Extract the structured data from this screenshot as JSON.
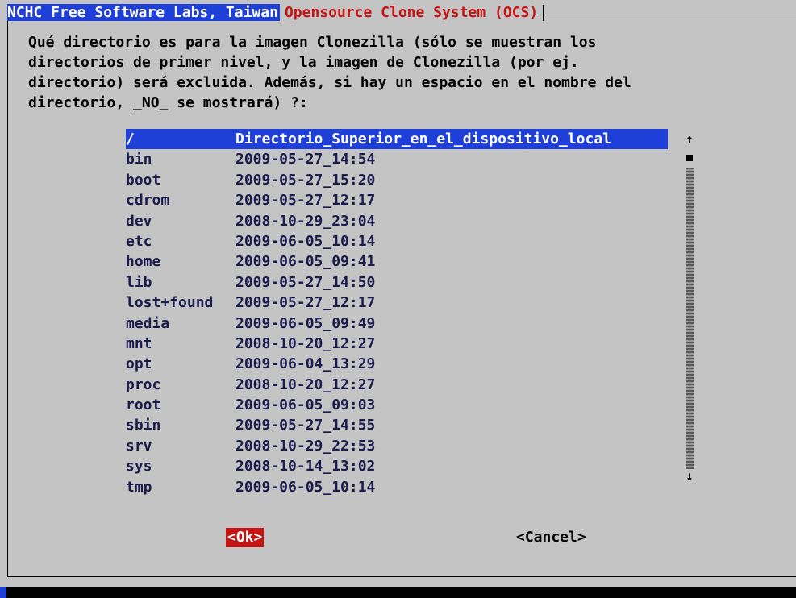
{
  "title": {
    "left": "NCHC Free Software Labs, Taiwan",
    "right": "Opensource Clone System (OCS)"
  },
  "prompt": "Qué directorio es para la imagen Clonezilla (sólo se muestran los\ndirectorios de primer nivel, y la imagen de Clonezilla (por ej.\ndirectorio) será excluida. Además, si hay un espacio en el nombre del\ndirectorio, _NO_ se mostrará) ?:",
  "list": [
    {
      "name": "/",
      "date": "Directorio_Superior_en_el_dispositivo_local",
      "selected": true
    },
    {
      "name": "bin",
      "date": "2009-05-27_14:54"
    },
    {
      "name": "boot",
      "date": "2009-05-27_15:20"
    },
    {
      "name": "cdrom",
      "date": "2009-05-27_12:17"
    },
    {
      "name": "dev",
      "date": "2008-10-29_23:04"
    },
    {
      "name": "etc",
      "date": "2009-06-05_10:14"
    },
    {
      "name": "home",
      "date": "2009-06-05_09:41"
    },
    {
      "name": "lib",
      "date": "2009-05-27_14:50"
    },
    {
      "name": "lost+found",
      "date": "2009-05-27_12:17"
    },
    {
      "name": "media",
      "date": "2009-06-05_09:49"
    },
    {
      "name": "mnt",
      "date": "2008-10-20_12:27"
    },
    {
      "name": "opt",
      "date": "2009-06-04_13:29"
    },
    {
      "name": "proc",
      "date": "2008-10-20_12:27"
    },
    {
      "name": "root",
      "date": "2009-06-05_09:03"
    },
    {
      "name": "sbin",
      "date": "2009-05-27_14:55"
    },
    {
      "name": "srv",
      "date": "2008-10-29_22:53"
    },
    {
      "name": "sys",
      "date": "2008-10-14_13:02"
    },
    {
      "name": "tmp",
      "date": "2009-06-05_10:14"
    }
  ],
  "scrollbar": {
    "up": "↑",
    "down": "↓"
  },
  "buttons": {
    "ok": "<Ok>",
    "cancel": "<Cancel>"
  }
}
